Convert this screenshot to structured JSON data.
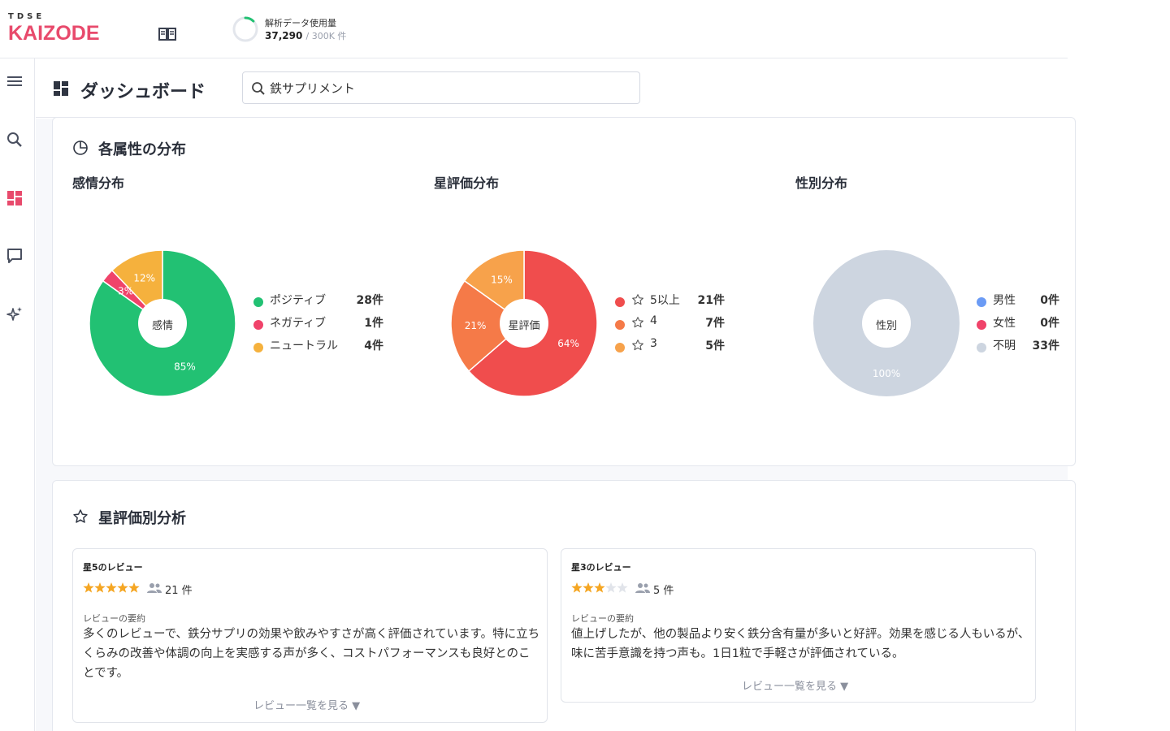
{
  "header": {
    "logo_small": "TDSE",
    "logo_main": "KAIZODE",
    "usage_label": "解析データ使用量",
    "usage_value": "37,290",
    "usage_limit": "/ 300K 件",
    "usage_ratio": 0.124
  },
  "page": {
    "title": "ダッシュボード",
    "search_value": "鉄サプリメント"
  },
  "attributes": {
    "title": "各属性の分布",
    "charts": [
      {
        "title": "感情分布",
        "center": "感情",
        "legend": [
          {
            "label": "ポジティブ",
            "count": "28件",
            "color": "#22c173"
          },
          {
            "label": "ネガティブ",
            "count": "1件",
            "color": "#f0436a"
          },
          {
            "label": "ニュートラル",
            "count": "4件",
            "color": "#f5b13d"
          }
        ]
      },
      {
        "title": "星評価分布",
        "center": "星評価",
        "legend": [
          {
            "label": "5以上",
            "count": "21件",
            "color": "#f04d4d"
          },
          {
            "label": "4",
            "count": "7件",
            "color": "#f57a48"
          },
          {
            "label": "3",
            "count": "5件",
            "color": "#f7a24b"
          }
        ]
      },
      {
        "title": "性別分布",
        "center": "性別",
        "legend": [
          {
            "label": "男性",
            "count": "0件",
            "color": "#6b9bf5"
          },
          {
            "label": "女性",
            "count": "0件",
            "color": "#f0436a"
          },
          {
            "label": "不明",
            "count": "33件",
            "color": "#cdd5e0"
          }
        ]
      }
    ]
  },
  "chart_data": [
    {
      "type": "pie",
      "title": "感情分布",
      "categories": [
        "ポジティブ",
        "ネガティブ",
        "ニュートラル"
      ],
      "values": [
        28,
        1,
        4
      ],
      "labels": [
        "85%",
        "3%",
        "12%"
      ],
      "colors": [
        "#22c173",
        "#f0436a",
        "#f5b13d"
      ]
    },
    {
      "type": "pie",
      "title": "星評価分布",
      "categories": [
        "5以上",
        "4",
        "3"
      ],
      "values": [
        21,
        7,
        5
      ],
      "labels": [
        "64%",
        "21%",
        "15%"
      ],
      "colors": [
        "#f04d4d",
        "#f57a48",
        "#f7a24b"
      ]
    },
    {
      "type": "pie",
      "title": "性別分布",
      "categories": [
        "男性",
        "女性",
        "不明"
      ],
      "values": [
        0,
        0,
        33
      ],
      "labels": [
        "",
        "",
        "100%"
      ],
      "colors": [
        "#6b9bf5",
        "#f0436a",
        "#cdd5e0"
      ]
    }
  ],
  "star_analysis": {
    "title": "星評価別分析",
    "reviews": [
      {
        "title": "星5のレビュー",
        "stars": 5,
        "count": "21 件",
        "summary_label": "レビューの要約",
        "summary": "多くのレビューで、鉄分サプリの効果や飲みやすさが高く評価されています。特に立ちくらみの改善や体調の向上を実感する声が多く、コストパフォーマンスも良好とのことです。",
        "link": "レビュー一覧を見る ▼"
      },
      {
        "title": "星3のレビュー",
        "stars": 3,
        "count": "5 件",
        "summary_label": "レビューの要約",
        "summary": "値上げしたが、他の製品より安く鉄分含有量が多いと好評。効果を感じる人もいるが、味に苦手意識を持つ声も。1日1粒で手軽さが評価されている。",
        "link": "レビュー一覧を見る ▼"
      }
    ]
  }
}
